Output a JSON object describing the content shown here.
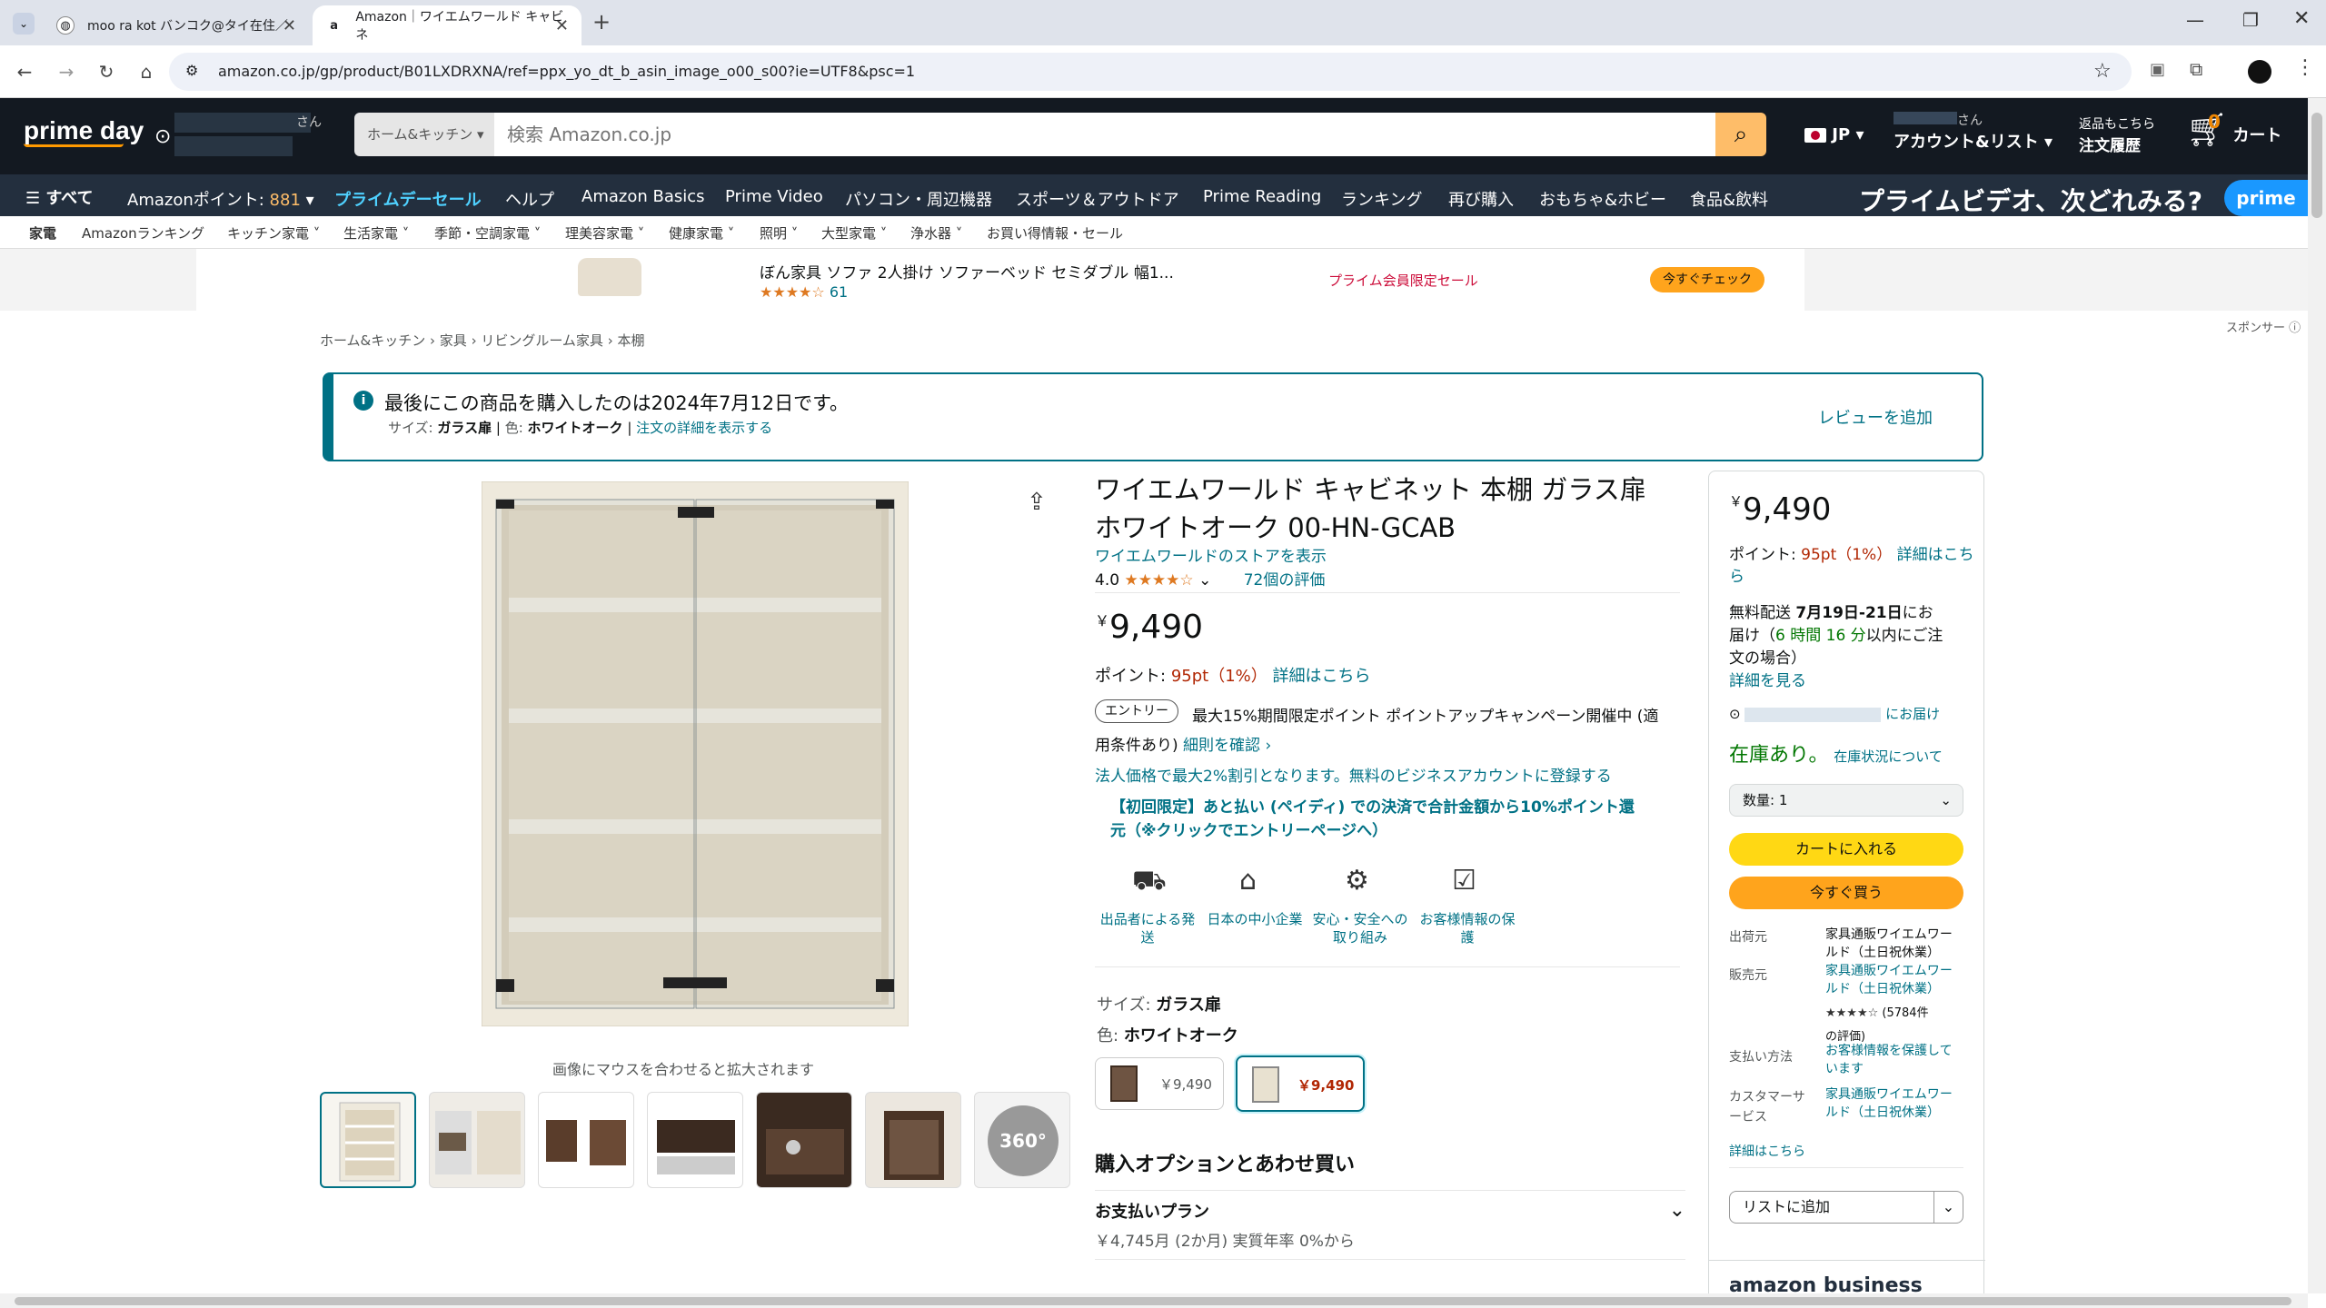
{
  "browser": {
    "tabs": [
      {
        "title": "moo ra kot バンコク@タイ在住／",
        "active": false
      },
      {
        "title": "Amazon｜ワイエムワールド キャビネ",
        "active": true
      }
    ],
    "url": "amazon.co.jp/gp/product/B01LXDRXNA/ref=ppx_yo_dt_b_asin_image_o00_s00?ie=UTF8&psc=1"
  },
  "header": {
    "logo": "prime day",
    "deliver_suffix": "さん",
    "search_category": "ホーム&キッチン",
    "search_placeholder": "検索 Amazon.co.jp",
    "lang": "JP",
    "account_top": "さん",
    "account_label": "アカウント&リスト",
    "returns_top": "返品もこちら",
    "returns_label": "注文履歴",
    "cart_count": "0",
    "cart_label": "カート"
  },
  "nav2": {
    "all": "すべて",
    "points_label": "Amazonポイント:",
    "points_value": "881",
    "items": [
      "プライムデーセール",
      "ヘルプ",
      "Amazon Basics",
      "Prime Video",
      "パソコン・周辺機器",
      "スポーツ＆アウトドア",
      "Prime Reading",
      "ランキング",
      "再び購入",
      "おもちゃ&ホビー",
      "食品&飲料"
    ],
    "banner": "プライムビデオ、次どれみる?",
    "banner_badge": "prime"
  },
  "subnav": [
    "家電",
    "Amazonランキング",
    "キッチン家電",
    "生活家電",
    "季節・空調家電",
    "理美容家電",
    "健康家電",
    "照明",
    "大型家電",
    "浄水器",
    "お買い得情報・セール"
  ],
  "promo": {
    "title": "ぼん家具 ソファ 2人掛け ソファーベッド セミダブル 幅1...",
    "reviews": "61",
    "tag": "プライム会員限定セール",
    "cta": "今すぐチェック",
    "sponsor": "スポンサー"
  },
  "breadcrumb": [
    "ホーム&キッチン",
    "家具",
    "リビングルーム家具",
    "本棚"
  ],
  "notice": {
    "text": "最後にこの商品を購入したのは2024年7月12日です。",
    "size_label": "サイズ:",
    "size_value": "ガラス扉",
    "color_label": "色:",
    "color_value": "ホワイトオーク",
    "details_link": "注文の詳細を表示する",
    "review_link": "レビューを追加"
  },
  "gallery": {
    "hint": "画像にマウスを合わせると拡大されます",
    "thumb360": "360°"
  },
  "product": {
    "title_line1": "ワイエムワールド キャビネット 本棚 ガラス扉",
    "title_line2": "ホワイトオーク 00-HN-GCAB",
    "store_link": "ワイエムワールドのストアを表示",
    "rating": "4.0",
    "stars": "★★★★☆",
    "review_count": "72個の評価",
    "price_symbol": "￥",
    "price": "9,490",
    "points_label": "ポイント:",
    "points_value": "95pt（1%）",
    "points_link": "詳細はこちら",
    "entry_badge": "エントリー",
    "campaign_line1": "最大15%期間限定ポイント ポイントアップキャンペーン開催中 (適",
    "campaign_line2": "用条件あり)",
    "campaign_link": "細則を確認 ›",
    "biz_link": "法人価格で最大2%割引となります。無料のビジネスアカウントに登録する",
    "paidy_line1": "【初回限定】あと払い (ペイディ) での決済で合計金額から10%ポイント還",
    "paidy_line2": "元（※クリックでエントリーページへ）",
    "features": [
      {
        "icon": "truck-icon",
        "label": "出品者による発送"
      },
      {
        "icon": "shop-icon",
        "label": "日本の中小企業"
      },
      {
        "icon": "safety-icon",
        "label": "安心・安全への取り組み"
      },
      {
        "icon": "clipboard-icon",
        "label": "お客様情報の保護"
      }
    ],
    "size_label": "サイズ:",
    "size_value": "ガラス扉",
    "color_label": "色:",
    "color_value": "ホワイトオーク",
    "swatch1_price": "￥9,490",
    "swatch2_price": "￥9,490",
    "options_heading": "購入オプションとあわせ買い",
    "plan_label": "お支払いプラン",
    "plan_sub": "￥4,745月 (2か月) 実質年率 0%から"
  },
  "buybox": {
    "price_symbol": "￥",
    "price": "9,490",
    "points_label": "ポイント:",
    "points_value": "95pt（1%）",
    "points_link": "詳細はこちら",
    "delivery_line1a": "無料配送",
    "delivery_date": "7月19日-21日",
    "delivery_line1b": "にお",
    "delivery_line2a": "届け（",
    "delivery_time": "6 時間 16 分",
    "delivery_line2b": "以内にご注",
    "delivery_line3": "文の場合）",
    "details_link": "詳細を見る",
    "deliver_to": "にお届け",
    "stock": "在庫あり。",
    "stock_link": "在庫状況について",
    "qty_label": "数量: 1",
    "add_cart": "カートに入れる",
    "buy_now": "今すぐ買う",
    "ship_label": "出荷元",
    "ship_value_1": "家具通販ワイエムワー",
    "ship_value_2": "ルド（土日祝休業）",
    "seller_label": "販売元",
    "seller_value_1": "家具通販ワイエムワー",
    "seller_value_2": "ルド（土日祝休業）",
    "seller_stars": "★★★★☆",
    "seller_count": "(5784件",
    "seller_count2": "の評価)",
    "pay_label": "支払い方法",
    "pay_value_1": "お客様情報を保護して",
    "pay_value_2": "います",
    "cs_label_1": "カスタマーサ",
    "cs_label_2": "ービス",
    "cs_value_1": "家具通販ワイエムワー",
    "cs_value_2": "ルド（土日祝休業）",
    "more_link": "詳細はこちら",
    "list_btn": "リストに追加",
    "business": "amazon business"
  },
  "colors": {
    "amazon_dark": "#131921",
    "amazon_nav2": "#232f3e",
    "link": "#007185",
    "price_red": "#b12704",
    "buy_yellow": "#ffd814",
    "buy_orange": "#ffa41c",
    "prime_blue": "#1a98ff",
    "stock_green": "#007600"
  }
}
